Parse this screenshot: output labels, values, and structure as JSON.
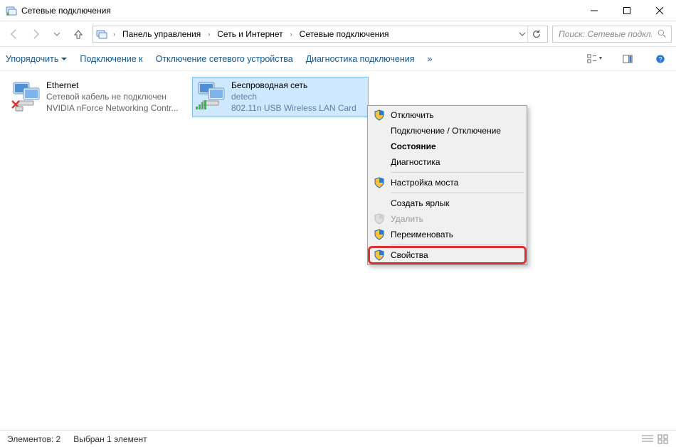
{
  "window": {
    "title": "Сетевые подключения"
  },
  "breadcrumb": {
    "items": [
      "Панель управления",
      "Сеть и Интернет",
      "Сетевые подключения"
    ]
  },
  "search": {
    "placeholder": "Поиск: Сетевые подкл..."
  },
  "toolbar": {
    "organize": "Упорядочить",
    "connect_to": "Подключение к",
    "disable_device": "Отключение сетевого устройства",
    "diagnose": "Диагностика подключения",
    "overflow": "»"
  },
  "connections": [
    {
      "name": "Ethernet",
      "status": "Сетевой кабель не подключен",
      "device": "NVIDIA nForce Networking Contr...",
      "selected": false,
      "disconnected": true
    },
    {
      "name": "Беспроводная сеть",
      "status": "detech",
      "device": "802.11n USB Wireless LAN Card",
      "selected": true,
      "disconnected": false
    }
  ],
  "context_menu": {
    "items": [
      {
        "label": "Отключить",
        "shield": true
      },
      {
        "label": "Подключение / Отключение",
        "shield": false
      },
      {
        "label": "Состояние",
        "shield": false,
        "bold": true
      },
      {
        "label": "Диагностика",
        "shield": false
      },
      {
        "sep": true
      },
      {
        "label": "Настройка моста",
        "shield": true
      },
      {
        "sep": true
      },
      {
        "label": "Создать ярлык",
        "shield": false
      },
      {
        "label": "Удалить",
        "shield": true,
        "disabled": true
      },
      {
        "label": "Переименовать",
        "shield": true
      },
      {
        "sep": true
      },
      {
        "label": "Свойства",
        "shield": true,
        "highlight": true
      }
    ]
  },
  "statusbar": {
    "count_label": "Элементов: 2",
    "selection_label": "Выбран 1 элемент"
  }
}
